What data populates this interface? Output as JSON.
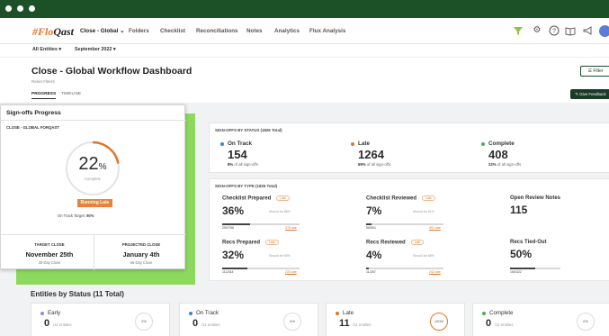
{
  "nav": {
    "logo_prefix": "#Flo",
    "logo_suffix": "Qast",
    "workspace": "Close - Global",
    "items": [
      "Folders",
      "Checklist",
      "Reconciliations",
      "Notes",
      "Analytics",
      "Flux Analysis"
    ]
  },
  "subbar": {
    "entities": "All Entities",
    "period": "September 2022"
  },
  "header": {
    "title": "Close - Global Workflow Dashboard",
    "reset": "Reset Filters",
    "tabs": [
      "PROGRESS",
      "TIMELINE"
    ],
    "filter": "Filter",
    "feedback": "Give Feedback"
  },
  "status": {
    "heading": "SIGN-OFFS BY STATUS (1826 Total)",
    "items": [
      {
        "label": "On Track",
        "value": "154",
        "pct": "8%",
        "suffix": "of all sign-offs",
        "color": "#3b82d6"
      },
      {
        "label": "Late",
        "value": "1264",
        "pct": "69%",
        "suffix": "of all sign-offs",
        "color": "#e0762c"
      },
      {
        "label": "Complete",
        "value": "408",
        "pct": "22%",
        "suffix": "of all sign-offs",
        "color": "#4caf50"
      }
    ]
  },
  "types": {
    "heading": "SIGN-OFFS BY TYPE (1826 Total)",
    "items": [
      {
        "title": "Checklist Prepared",
        "badge": "Late",
        "pct": "36%",
        "should": "Should be 86%",
        "count": "290/766",
        "late": "375 late",
        "progress": 0.36
      },
      {
        "title": "Checklist Reviewed",
        "badge": "Late",
        "pct": "7%",
        "should": "Should be 61%",
        "count": "56/591",
        "late": "401 late",
        "progress": 0.07
      },
      {
        "title": "Open Review Notes",
        "pct": "115"
      },
      {
        "title": "Recs Prepared",
        "badge": "Late",
        "pct": "32%",
        "should": "Should be 90%",
        "count": "111/344",
        "late": "225 late",
        "progress": 0.32
      },
      {
        "title": "Recs Reviewed",
        "badge": "Late",
        "pct": "4%",
        "should": "Should be 58%",
        "count": "11/257",
        "late": "242 late",
        "progress": 0.04
      },
      {
        "title": "Recs Tied-Out",
        "pct": "50%",
        "count": "160/322",
        "progress": 0.5
      }
    ]
  },
  "signoffs": {
    "title": "Sign-offs Progress",
    "subtitle": "CLOSE - GLOBAL FORQAST",
    "percent": "22",
    "percent_sign": "%",
    "progress": 0.22,
    "ring_label": "Complete",
    "running": "Running Late",
    "target_prefix": "On Track Target:",
    "target_value": "90%",
    "target_close_label": "TARGET CLOSE",
    "target_close_date": "November 25th",
    "target_close_sub": "30-Day Close",
    "projected_close_label": "PROJECTED CLOSE",
    "projected_close_date": "January 4th",
    "projected_close_sub": "66-Day Close"
  },
  "entities": {
    "title": "Entities by Status (11 Total)",
    "items": [
      {
        "label": "Early",
        "value": "0",
        "of": "/11 entities",
        "ring": "0%",
        "color": "#8a8fd1"
      },
      {
        "label": "On Track",
        "value": "0",
        "of": "/11 entities",
        "ring": "0%",
        "color": "#3b82d6"
      },
      {
        "label": "Late",
        "value": "11",
        "of": "/11 entities",
        "ring": "100%",
        "color": "#e0762c"
      },
      {
        "label": "Complete",
        "value": "0",
        "of": "/11 entities",
        "ring": "0%",
        "color": "#4caf50"
      }
    ]
  },
  "colors": {
    "brand_green": "#1c5128",
    "accent_orange": "#e0762c",
    "highlight_green": "#8dd95d"
  }
}
